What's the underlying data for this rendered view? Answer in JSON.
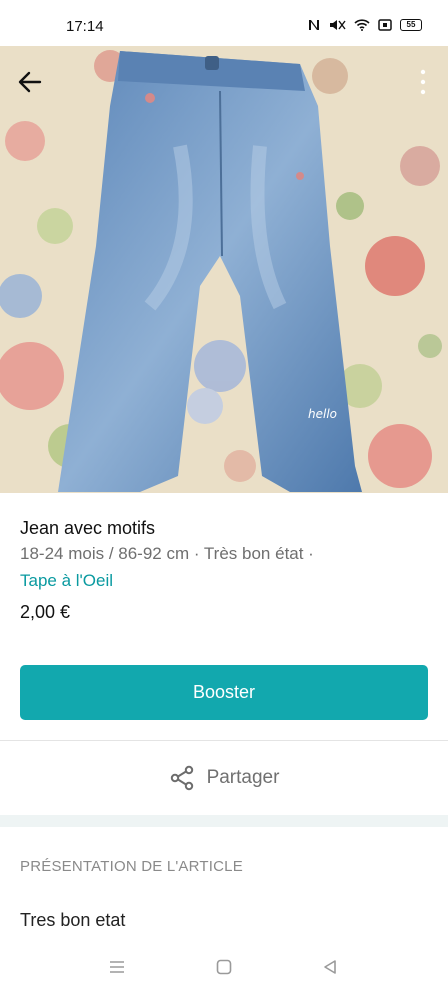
{
  "status_bar": {
    "time": "17:14",
    "battery": "55",
    "icons": [
      "nfc-icon",
      "mute-icon",
      "wifi-icon",
      "screen-record-icon",
      "battery-icon"
    ]
  },
  "photo": {
    "description_icon_back": "arrow-left-icon",
    "description_icon_more": "more-vertical-icon"
  },
  "item": {
    "title": "Jean avec motifs",
    "meta": "18-24 mois / 86-92 cm · Très bon état ·",
    "brand": "Tape à l'Oeil",
    "price": "2,00 €"
  },
  "actions": {
    "boost_label": "Booster",
    "share_label": "Partager"
  },
  "section": {
    "title": "PRÉSENTATION DE L'ARTICLE",
    "description": "Tres bon etat"
  },
  "colors": {
    "accent": "#12a8ae",
    "brand_link": "#0a9aa0"
  }
}
